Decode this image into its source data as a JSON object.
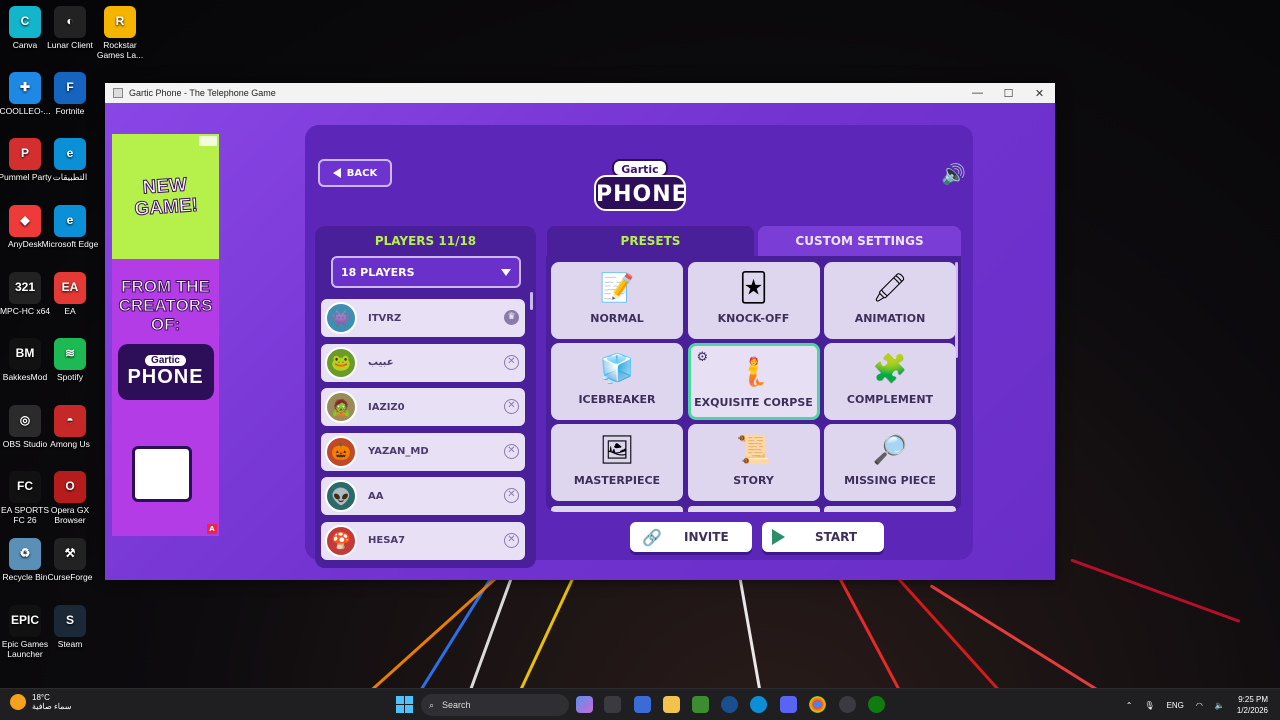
{
  "desktop": {
    "icons": [
      {
        "label": "Canva",
        "color": "#12b5cb",
        "glyph": "C"
      },
      {
        "label": "Lunar Client",
        "color": "#222",
        "glyph": "◐"
      },
      {
        "label": "Rockstar Games La...",
        "color": "#f4b400",
        "glyph": "R"
      },
      {
        "label": "COOLLEO-...",
        "color": "#1e88e5",
        "glyph": "✚"
      },
      {
        "label": "Fortnite",
        "color": "#1565c0",
        "glyph": "F"
      },
      {
        "label": "Pummel Party",
        "color": "#d32f2f",
        "glyph": "P"
      },
      {
        "label": "التطبيقات",
        "color": "#0b8fd6",
        "glyph": "e"
      },
      {
        "label": "AnyDesk",
        "color": "#ef3a3a",
        "glyph": "◆"
      },
      {
        "label": "Microsoft Edge",
        "color": "#0b8fd6",
        "glyph": "e"
      },
      {
        "label": "MPC-HC x64",
        "color": "#222",
        "glyph": "321"
      },
      {
        "label": "EA",
        "color": "#e53935",
        "glyph": "EA"
      },
      {
        "label": "BakkesMod",
        "color": "#111",
        "glyph": "BM"
      },
      {
        "label": "Spotify",
        "color": "#1db954",
        "glyph": "≋"
      },
      {
        "label": "OBS Studio",
        "color": "#2b2b2b",
        "glyph": "◎"
      },
      {
        "label": "Among Us",
        "color": "#c62828",
        "glyph": "◓"
      },
      {
        "label": "EA SPORTS FC 26",
        "color": "#111",
        "glyph": "FC"
      },
      {
        "label": "Opera GX Browser",
        "color": "#b71c1c",
        "glyph": "O"
      },
      {
        "label": "Recycle Bin",
        "color": "#5a8fb8",
        "glyph": "♻"
      },
      {
        "label": "CurseForge",
        "color": "#222",
        "glyph": "⚒"
      },
      {
        "label": "Epic Games Launcher",
        "color": "#111",
        "glyph": "EPIC"
      },
      {
        "label": "Steam",
        "color": "#1b2838",
        "glyph": "S"
      }
    ]
  },
  "window": {
    "title": "Gartic Phone - The Telephone Game",
    "minimize": "—",
    "maximize": "☐",
    "close": "✕"
  },
  "ad": {
    "headline": "NEW GAME!",
    "from_text": "FROM THE CREATORS OF:",
    "logo_top": "Gartic",
    "logo_bottom": "PHONE",
    "badge": "A"
  },
  "game": {
    "back_label": "BACK",
    "logo_top": "Gartic",
    "logo_bottom": "PHONE",
    "sound_icon": "🔊",
    "players_title": "PLAYERS 11/18",
    "players_select": "18 PLAYERS",
    "players": [
      {
        "name": "ITVRZ",
        "avatar": "👾",
        "color": "#3e8fb0",
        "action": "♛",
        "host": true
      },
      {
        "name": "عبيب",
        "avatar": "🐸",
        "color": "#6a9a2a",
        "action": "✕",
        "host": false
      },
      {
        "name": "IAZIZ0",
        "avatar": "🧟",
        "color": "#9a8c5a",
        "action": "✕",
        "host": false
      },
      {
        "name": "YAZAN_MD",
        "avatar": "🎃",
        "color": "#c0492a",
        "action": "✕",
        "host": false
      },
      {
        "name": "AA",
        "avatar": "👽",
        "color": "#2a6a6a",
        "action": "✕",
        "host": false
      },
      {
        "name": "HESA7",
        "avatar": "🍄",
        "color": "#c23a3a",
        "action": "✕",
        "host": false
      }
    ],
    "tabs": {
      "presets": "PRESETS",
      "custom": "CUSTOM SETTINGS"
    },
    "presets": [
      {
        "label": "NORMAL",
        "icon": "📝"
      },
      {
        "label": "KNOCK-OFF",
        "icon": "🃏"
      },
      {
        "label": "ANIMATION",
        "icon": "🖍"
      },
      {
        "label": "ICEBREAKER",
        "icon": "🧊"
      },
      {
        "label": "EXQUISITE CORPSE",
        "icon": "🧜"
      },
      {
        "label": "COMPLEMENT",
        "icon": "🧩"
      },
      {
        "label": "MASTERPIECE",
        "icon": "🖼"
      },
      {
        "label": "STORY",
        "icon": "📜"
      },
      {
        "label": "MISSING PIECE",
        "icon": "🔎"
      }
    ],
    "selected_preset": "EXQUISITE CORPSE",
    "gear_icon": "⚙",
    "invite_label": "INVITE",
    "start_label": "START",
    "invite_icon": "🔗"
  },
  "taskbar": {
    "weather_temp": "18°C",
    "weather_desc": "سماء صافية",
    "search_placeholder": "Search",
    "language": "ENG",
    "time": "9:25 PM",
    "date": "1/2/2026"
  }
}
